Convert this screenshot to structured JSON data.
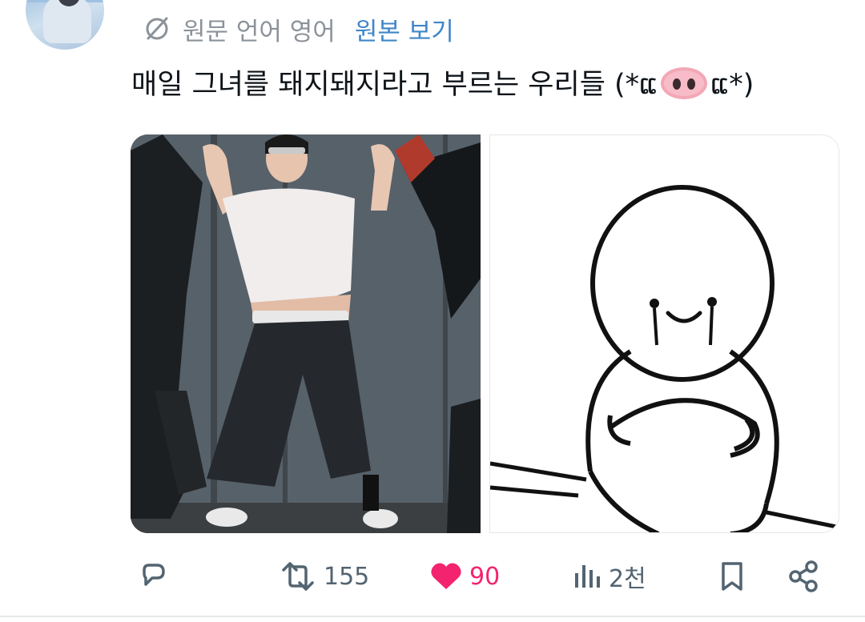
{
  "translation": {
    "source_label": "원문 언어 영어",
    "view_original": "원본 보기"
  },
  "tweet": {
    "text_before": "매일 그녀를 돼지돼지라고 부르는 우리들 (*ແ",
    "text_after": "ແ*)",
    "emoji": "pig-nose-icon"
  },
  "media": [
    {
      "name": "dance-photo",
      "description_icon": "photo-icon"
    },
    {
      "name": "cartoon-character",
      "description_icon": "illustration-icon"
    }
  ],
  "actions": {
    "reply": {
      "icon": "reply-icon"
    },
    "retweet": {
      "icon": "retweet-icon",
      "count": "155"
    },
    "like": {
      "icon": "heart-icon",
      "count": "90",
      "color": "#f4236f"
    },
    "views": {
      "icon": "views-icon",
      "count": "2천"
    },
    "bookmark": {
      "icon": "bookmark-icon"
    },
    "share": {
      "icon": "share-icon"
    }
  },
  "colors": {
    "link": "#3f86c8",
    "muted": "#536471",
    "like": "#f4236f"
  }
}
